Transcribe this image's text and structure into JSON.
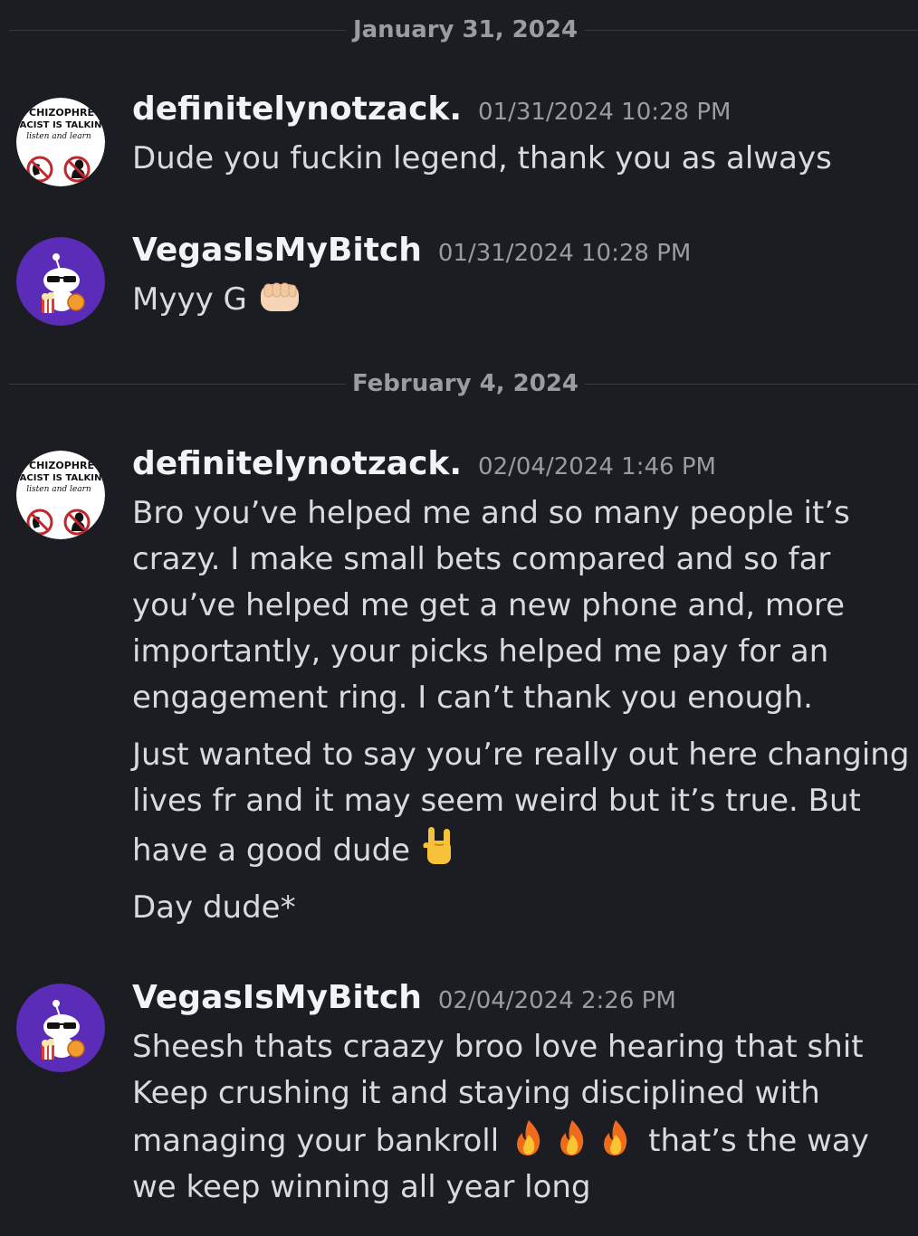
{
  "dividers": {
    "first": "January 31, 2024",
    "second": "February 4, 2024"
  },
  "avatars": {
    "zack": {
      "line1": "CHIZOPHRE",
      "line2": "ACIST IS TALKIN",
      "line3": "listen and learn"
    }
  },
  "messages": [
    {
      "author": "definitelynotzack.",
      "timestamp": "01/31/2024 10:28 PM",
      "paragraphs": [
        "Dude you fuckin legend, thank you as always"
      ]
    },
    {
      "author": "VegasIsMyBitch",
      "timestamp": "01/31/2024 10:28 PM",
      "paragraphs": [
        "Myyy G"
      ],
      "emoji": "fist-bump-icon"
    },
    {
      "author": "definitelynotzack.",
      "timestamp": "02/04/2024 1:46 PM",
      "paragraphs": [
        "Bro you’ve helped me and so many people it’s crazy. I make small bets compared and so far you’ve helped me get a new phone and, more importantly, your picks helped me pay for an engagement ring. I can’t thank you enough.",
        "Just wanted to say you’re really out here changing lives fr and it may seem weird but it’s true. But have a good dude",
        "Day dude*"
      ],
      "emoji": "rock-on-hand-icon"
    },
    {
      "author": "VegasIsMyBitch",
      "timestamp": "02/04/2024 2:26 PM",
      "paragraphs": [
        "Sheesh thats craazy broo love hearing that shit",
        "Keep crushing it and staying disciplined with managing your bankroll",
        "that’s the way we keep winning all year long"
      ],
      "emoji": "fire-icon"
    }
  ]
}
